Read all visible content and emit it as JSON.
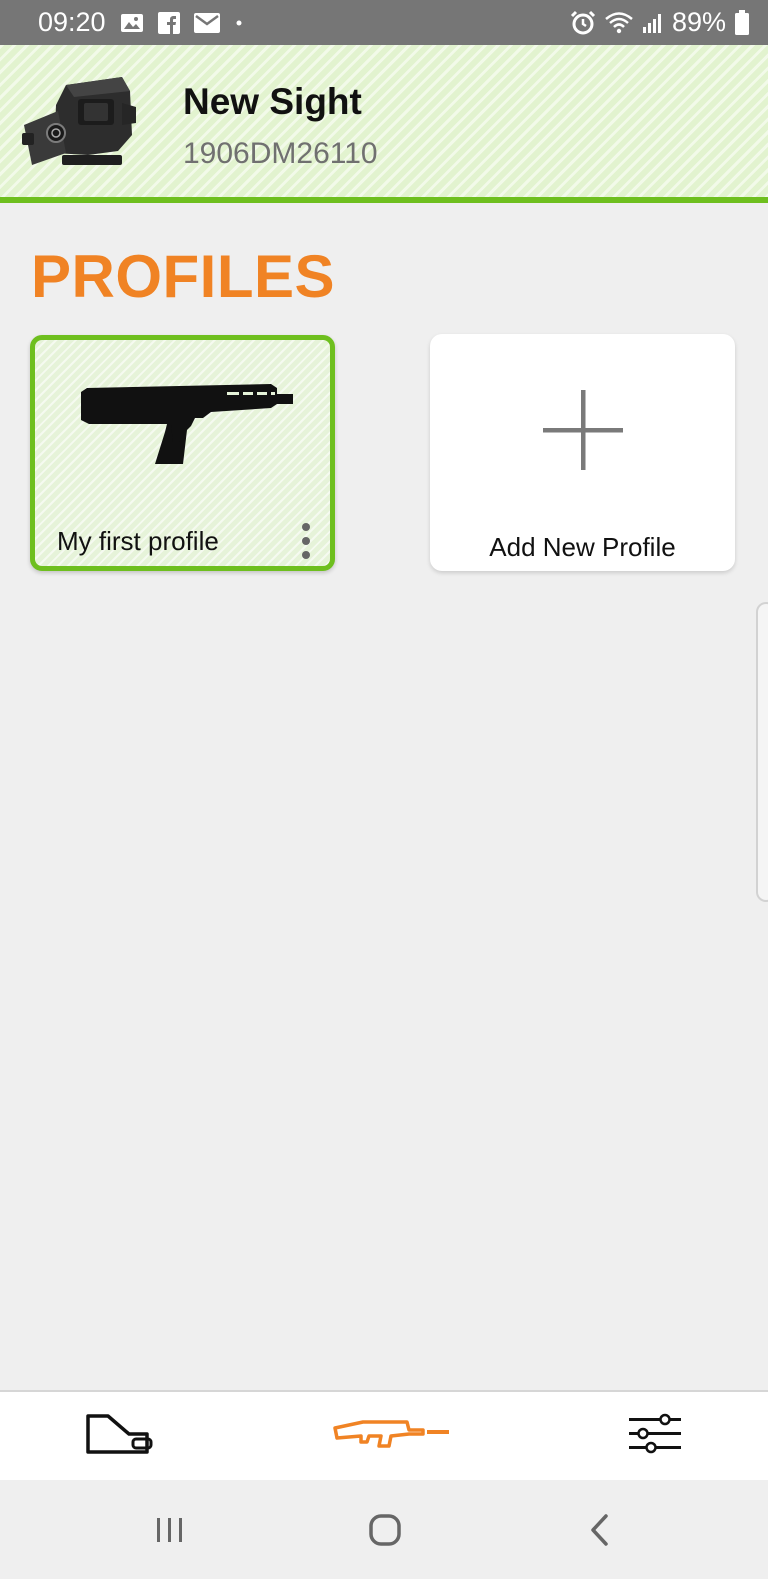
{
  "status_bar": {
    "time": "09:20",
    "battery": "89%",
    "left_icons": [
      "gallery-icon",
      "facebook-icon",
      "mail-icon",
      "dot-icon"
    ],
    "right_icons": [
      "alarm-icon",
      "wifi-icon",
      "signal-icon",
      "battery-icon"
    ]
  },
  "device": {
    "name": "New Sight",
    "serial": "1906DM26110",
    "image": "red-dot-sight-image"
  },
  "profiles": {
    "title": "PROFILES",
    "items": [
      {
        "label": "My first profile",
        "icon": "shotgun-icon",
        "selected": true
      }
    ],
    "add_label": "Add New Profile"
  },
  "bottom_nav": {
    "items": [
      {
        "icon": "sight-icon",
        "active": false
      },
      {
        "icon": "rifle-icon",
        "active": true
      },
      {
        "icon": "sliders-icon",
        "active": false
      }
    ]
  },
  "android_nav": {
    "items": [
      "recents-icon",
      "home-icon",
      "back-icon"
    ]
  },
  "colors": {
    "accent_orange": "#f08324",
    "accent_green": "#6ebf1e",
    "status_bar": "#767676",
    "background": "#efefef"
  }
}
